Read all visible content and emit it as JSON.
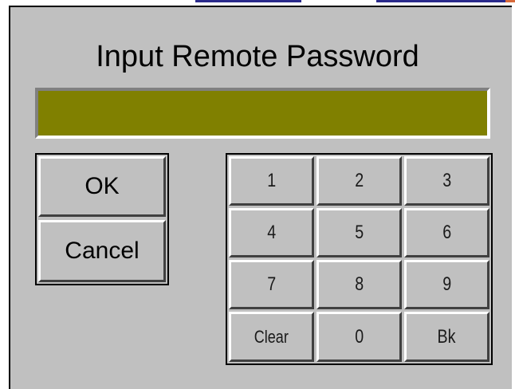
{
  "dialog": {
    "title": "Input Remote Password",
    "password_value": ""
  },
  "actions": {
    "ok_label": "OK",
    "cancel_label": "Cancel"
  },
  "keypad": {
    "keys": [
      "1",
      "2",
      "3",
      "4",
      "5",
      "6",
      "7",
      "8",
      "9",
      "Clear",
      "0",
      "Bk"
    ]
  },
  "colors": {
    "panel": "#c0c0c0",
    "display": "#808000",
    "accent_strip": "#2a2a8c",
    "accent_corner": "#d86a3a"
  }
}
